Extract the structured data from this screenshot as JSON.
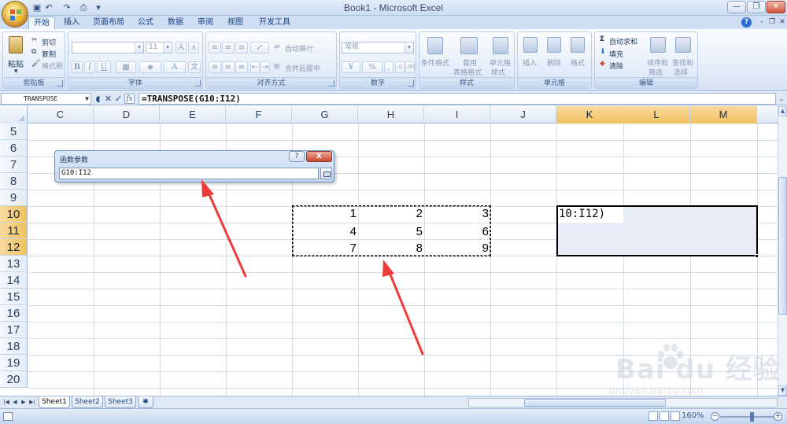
{
  "window": {
    "title": "Book1 - Microsoft Excel",
    "minimize": "—",
    "restore": "❐",
    "close": "✕"
  },
  "ribbon_tabs": [
    "开始",
    "插入",
    "页面布局",
    "公式",
    "数据",
    "审阅",
    "视图",
    "开发工具"
  ],
  "ribbon": {
    "clipboard": {
      "label": "剪贴板",
      "paste": "粘贴",
      "cut": "剪切",
      "copy": "复制",
      "format_painter": "格式刷"
    },
    "font": {
      "label": "字体",
      "font_size": "11",
      "bold": "B",
      "italic": "I",
      "underline": "U"
    },
    "alignment": {
      "label": "对齐方式",
      "wrap_text": "自动换行",
      "merge_center": "合并后居中"
    },
    "number": {
      "label": "数字",
      "format": "常规",
      "percent": "%"
    },
    "styles": {
      "label": "样式",
      "conditional_format": "条件格式",
      "format_table_1": "套用",
      "format_table_2": "表格格式",
      "cell_styles_1": "单元格",
      "cell_styles_2": "样式"
    },
    "cells": {
      "label": "单元格",
      "insert": "插入",
      "delete": "删除",
      "format": "格式"
    },
    "editing": {
      "label": "编辑",
      "autosum": "自动求和",
      "fill": "填充",
      "clear": "清除",
      "sort_filter_1": "排序和",
      "sort_filter_2": "筛选",
      "find_select_1": "查找和",
      "find_select_2": "选择"
    }
  },
  "formula_bar": {
    "name_box": "TRANSPOSE",
    "cancel": "✕",
    "enter": "✓",
    "fx": "fx",
    "formula": "=TRANSPOSE(G10:I12)"
  },
  "columns": [
    "C",
    "D",
    "E",
    "F",
    "G",
    "H",
    "I",
    "J",
    "K",
    "L",
    "M"
  ],
  "selected_columns": [
    "K",
    "L",
    "M"
  ],
  "rows": [
    "5",
    "6",
    "7",
    "8",
    "9",
    "10",
    "11",
    "12",
    "13",
    "14",
    "15",
    "16",
    "17",
    "18",
    "19",
    "20"
  ],
  "selected_rows": [
    "10",
    "11",
    "12"
  ],
  "cells": {
    "g10": "1",
    "h10": "2",
    "i10": "3",
    "g11": "4",
    "h11": "5",
    "i11": "6",
    "g12": "7",
    "h12": "8",
    "i12": "9",
    "k10": "10:I12)"
  },
  "dialog": {
    "title": "函数参数",
    "help": "?",
    "close": "X",
    "input_value": "G10:I12"
  },
  "sheets": [
    "Sheet1",
    "Sheet2",
    "Sheet3"
  ],
  "active_sheet": "Sheet1",
  "status": {
    "zoom": "160%"
  },
  "watermark": {
    "main": "Bai du 经验",
    "sub": "jingyan.baidu.com"
  },
  "colors": {
    "accent": "#f1c15f",
    "annotation_arrow": "#ee3b3b",
    "ribbon_bg": "#dfe8f5"
  }
}
